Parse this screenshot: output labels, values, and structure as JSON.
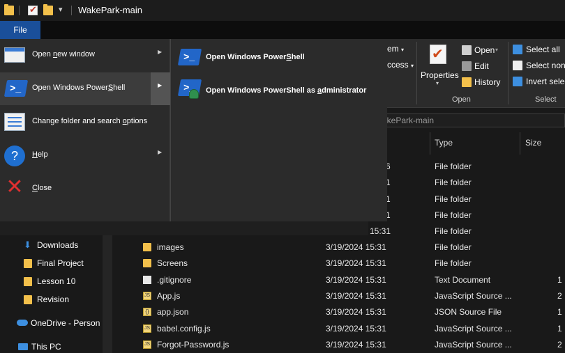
{
  "window": {
    "title": "WakePark-main"
  },
  "ribbon": {
    "file_tab": "File",
    "partial_item": "em",
    "partial_access": "ccess",
    "properties": "Properties",
    "open": "Open",
    "edit": "Edit",
    "history": "History",
    "group_open": "Open",
    "select_all": "Select all",
    "select_none": "Select none",
    "invert_selection": "Invert selec",
    "group_select": "Select"
  },
  "address": {
    "path_partial": "akePark-main"
  },
  "columns": {
    "type": "Type",
    "size": "Size"
  },
  "nav": {
    "items": [
      {
        "label": "Downloads",
        "icon": "download-arrow-icon"
      },
      {
        "label": "Final Project",
        "icon": "folder-icon"
      },
      {
        "label": "Lesson 10",
        "icon": "folder-icon"
      },
      {
        "label": "Revision",
        "icon": "folder-icon"
      },
      {
        "label": "OneDrive - Person",
        "icon": "cloud-icon"
      },
      {
        "label": "This PC",
        "icon": "computer-icon"
      }
    ]
  },
  "files": {
    "partial_rows": [
      {
        "date_tail": "6",
        "type": "File folder"
      },
      {
        "date_tail": "1",
        "type": "File folder"
      },
      {
        "date_tail": "1",
        "type": "File folder"
      },
      {
        "date_tail": "1",
        "type": "File folder"
      },
      {
        "date_tail": "15:31",
        "type": "File folder"
      }
    ],
    "rows": [
      {
        "name": "images",
        "date": "3/19/2024 15:31",
        "type": "File folder",
        "size": "",
        "icon": "folder-icon"
      },
      {
        "name": "Screens",
        "date": "3/19/2024 15:31",
        "type": "File folder",
        "size": "",
        "icon": "folder-icon"
      },
      {
        "name": ".gitignore",
        "date": "3/19/2024 15:31",
        "type": "Text Document",
        "size": "1",
        "icon": "text-file-icon"
      },
      {
        "name": "App.js",
        "date": "3/19/2024 15:31",
        "type": "JavaScript Source ...",
        "size": "2",
        "icon": "js-file-icon"
      },
      {
        "name": "app.json",
        "date": "3/19/2024 15:31",
        "type": "JSON Source File",
        "size": "1",
        "icon": "json-file-icon"
      },
      {
        "name": "babel.config.js",
        "date": "3/19/2024 15:31",
        "type": "JavaScript Source ...",
        "size": "1",
        "icon": "js-file-icon"
      },
      {
        "name": "Forgot-Password.js",
        "date": "3/19/2024 15:31",
        "type": "JavaScript Source ...",
        "size": "2",
        "icon": "js-file-icon"
      }
    ]
  },
  "file_menu": {
    "items": [
      {
        "pre": "Open ",
        "u": "n",
        "post": "ew window",
        "has_submenu": true
      },
      {
        "pre": "Open Windows Power",
        "u": "S",
        "post": "hell",
        "has_submenu": true,
        "highlighted": true
      },
      {
        "pre": "Change folder and search ",
        "u": "o",
        "post": "ptions",
        "has_submenu": false
      },
      {
        "pre": "",
        "u": "H",
        "post": "elp",
        "has_submenu": true
      },
      {
        "pre": "",
        "u": "C",
        "post": "lose",
        "has_submenu": false
      }
    ]
  },
  "powershell_submenu": {
    "items": [
      {
        "pre": "Open Windows Power",
        "u": "S",
        "post": "hell"
      },
      {
        "pre": "Open Windows PowerShell as ",
        "u": "a",
        "post": "dministrator"
      }
    ]
  },
  "colors": {
    "accent": "#1a4f9a",
    "folder": "#f3c04b",
    "menu_bg": "#2b2b2b",
    "menu_highlight": "#3c3c3c",
    "close_red": "#e03030",
    "powershell_blue": "#2266c8"
  }
}
